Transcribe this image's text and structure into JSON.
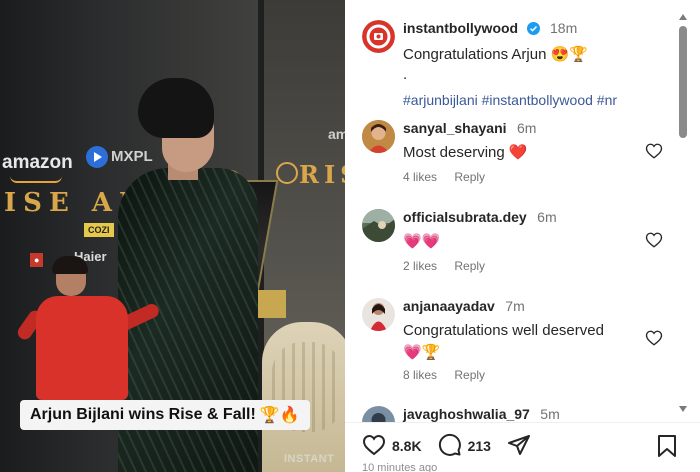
{
  "video": {
    "caption_text": "Arjun Bijlani wins Rise & Fall!",
    "caption_emojis": "🏆🔥",
    "sponsor_amazon": "amazon",
    "sponsor_mx": "MXPL",
    "backdrop_text_left": "ISE AND",
    "backdrop_text_right": "RIS",
    "backdrop_small_right": "am",
    "logo_cozi": "COZI",
    "logo_haier": "Haier",
    "watermark": "INSTANT"
  },
  "post": {
    "username": "instantbollywood",
    "time": "18m",
    "caption": "Congratulations Arjun 😍🏆",
    "dot": ".",
    "hashtags": "#arjunbijlani #instantbollywood #nr"
  },
  "comments": [
    {
      "username": "sanyal_shayani",
      "time": "6m",
      "text": "Most deserving ❤️",
      "likes": "4 likes",
      "reply": "Reply"
    },
    {
      "username": "officialsubrata.dey",
      "time": "6m",
      "text": "💗💗",
      "likes": "2 likes",
      "reply": "Reply"
    },
    {
      "username": "anjanaayadav",
      "time": "7m",
      "text": "Congratulations well deserved",
      "text2": "💗🏆",
      "likes": "8 likes",
      "reply": "Reply"
    },
    {
      "username": "javaghoshwalia_97",
      "time": "5m"
    }
  ],
  "actions": {
    "like_count": "8.8K",
    "comment_count": "213"
  },
  "footer_peek": "10 minutes ago",
  "colors": {
    "accent_link": "#3b5998",
    "verified_blue": "#1d9bf0",
    "heart_red": "#e41e3f"
  }
}
